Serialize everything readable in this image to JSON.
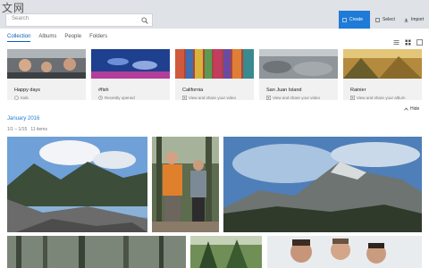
{
  "watermark": "文网",
  "search": {
    "placeholder": "Search"
  },
  "toolbar": {
    "create_label": "Create",
    "select_label": "Select",
    "import_label": "Import"
  },
  "tabs": [
    {
      "label": "Collection",
      "active": true
    },
    {
      "label": "Albums",
      "active": false
    },
    {
      "label": "People",
      "active": false
    },
    {
      "label": "Folders",
      "active": false
    }
  ],
  "albums": [
    {
      "name": "Happy days",
      "subtitle": "Kids",
      "icon": "smiley-icon"
    },
    {
      "name": "#fish",
      "subtitle": "Recently opened",
      "icon": "clock-icon"
    },
    {
      "name": "California",
      "subtitle": "View and share your video",
      "icon": "play-icon"
    },
    {
      "name": "San Juan Island",
      "subtitle": "View and share your video",
      "icon": "play-icon"
    },
    {
      "name": "Rainier",
      "subtitle": "View and share your album",
      "icon": "play-icon"
    }
  ],
  "section": {
    "hide_label": "Hide",
    "month": "January 2016",
    "range": "1/1 – 1/15",
    "count": "11 items"
  },
  "colors": {
    "accent": "#1f7bd6",
    "active_tab": "#0b5fb0"
  }
}
